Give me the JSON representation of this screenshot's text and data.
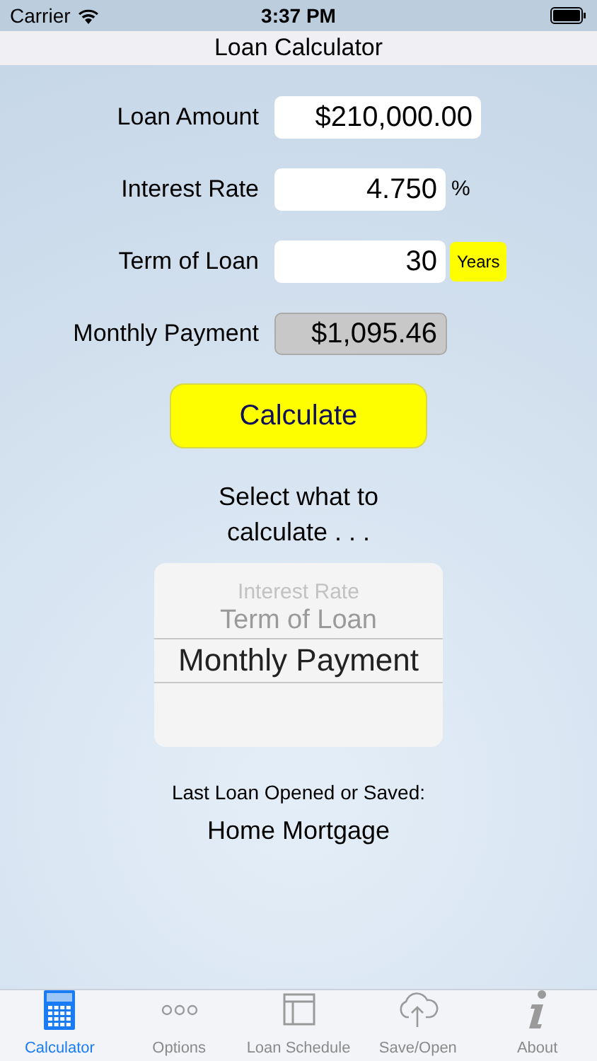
{
  "status_bar": {
    "carrier": "Carrier",
    "time": "3:37 PM"
  },
  "nav_bar": {
    "title": "Loan Calculator"
  },
  "fields": [
    {
      "label": "Loan Amount",
      "value": "$210,000.00",
      "disabled": false
    },
    {
      "label": "Interest Rate",
      "value": "4.750",
      "disabled": false,
      "unit": "%"
    },
    {
      "label": "Term of Loan",
      "value": "30",
      "disabled": false,
      "badge": "Years"
    },
    {
      "label": "Monthly Payment",
      "value": "$1,095.46",
      "disabled": true
    }
  ],
  "calculate_button": "Calculate",
  "picker_prompt": "Select what to calculate . . .",
  "picker": [
    {
      "label": "Interest Rate",
      "selected": false
    },
    {
      "label": "Term of Loan",
      "selected": false
    },
    {
      "label": "Monthly Payment",
      "selected": true
    }
  ],
  "last_loan": {
    "caption": "Last Loan Opened or Saved:",
    "name": "Home Mortgage"
  },
  "tabs": [
    {
      "label": "Calculator",
      "selected": true
    },
    {
      "label": "Options",
      "selected": false
    },
    {
      "label": "Loan Schedule",
      "selected": false
    },
    {
      "label": "Save/Open",
      "selected": false
    },
    {
      "label": "About",
      "selected": false
    }
  ]
}
